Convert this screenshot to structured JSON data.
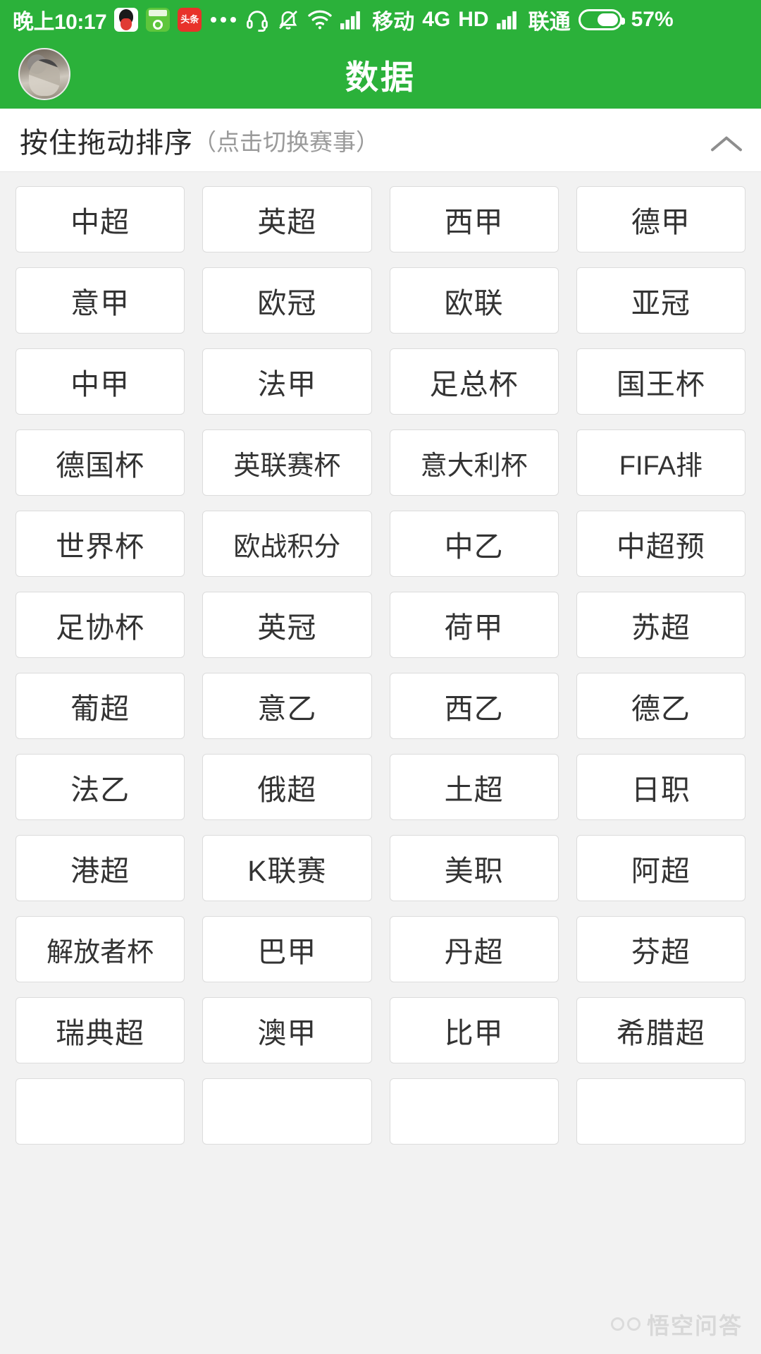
{
  "theme": {
    "brand_green": "#2bb13a",
    "page_bg": "#f2f2f2",
    "tile_bg": "#ffffff",
    "tile_border": "#dcdcdc",
    "text": "#333333"
  },
  "status_bar": {
    "time": "晚上10:17",
    "app_icons": [
      {
        "name": "qq-icon",
        "label": "QQ"
      },
      {
        "name": "football-app-icon",
        "label": "球"
      },
      {
        "name": "toutiao-icon",
        "label": "头条"
      }
    ],
    "more_indicator": "...",
    "icons": [
      "headset-icon",
      "bell-muted-icon",
      "wifi-icon",
      "signal-bars-icon"
    ],
    "carrier_1": "移动",
    "network_type": "4G",
    "hd_label": "HD",
    "carrier_2": "联通",
    "battery_percent": "57%",
    "battery_level": 57
  },
  "app_bar": {
    "title": "数据",
    "avatar_name": "user-avatar"
  },
  "sort_header": {
    "main_text": "按住拖动排序",
    "sub_text": "（点击切换赛事）",
    "collapse_icon": "chevron-up-icon"
  },
  "league_grid": {
    "columns": 4,
    "tiles": [
      "中超",
      "英超",
      "西甲",
      "德甲",
      "意甲",
      "欧冠",
      "欧联",
      "亚冠",
      "中甲",
      "法甲",
      "足总杯",
      "国王杯",
      "德国杯",
      "英联赛杯",
      "意大利杯",
      "FIFA排",
      "世界杯",
      "欧战积分",
      "中乙",
      "中超预",
      "足协杯",
      "英冠",
      "荷甲",
      "苏超",
      "葡超",
      "意乙",
      "西乙",
      "德乙",
      "法乙",
      "俄超",
      "土超",
      "日职",
      "港超",
      "K联赛",
      "美职",
      "阿超",
      "解放者杯",
      "巴甲",
      "丹超",
      "芬超",
      "瑞典超",
      "澳甲",
      "比甲",
      "希腊超",
      "",
      "",
      "",
      ""
    ]
  },
  "watermark": {
    "text": "悟空问答"
  }
}
